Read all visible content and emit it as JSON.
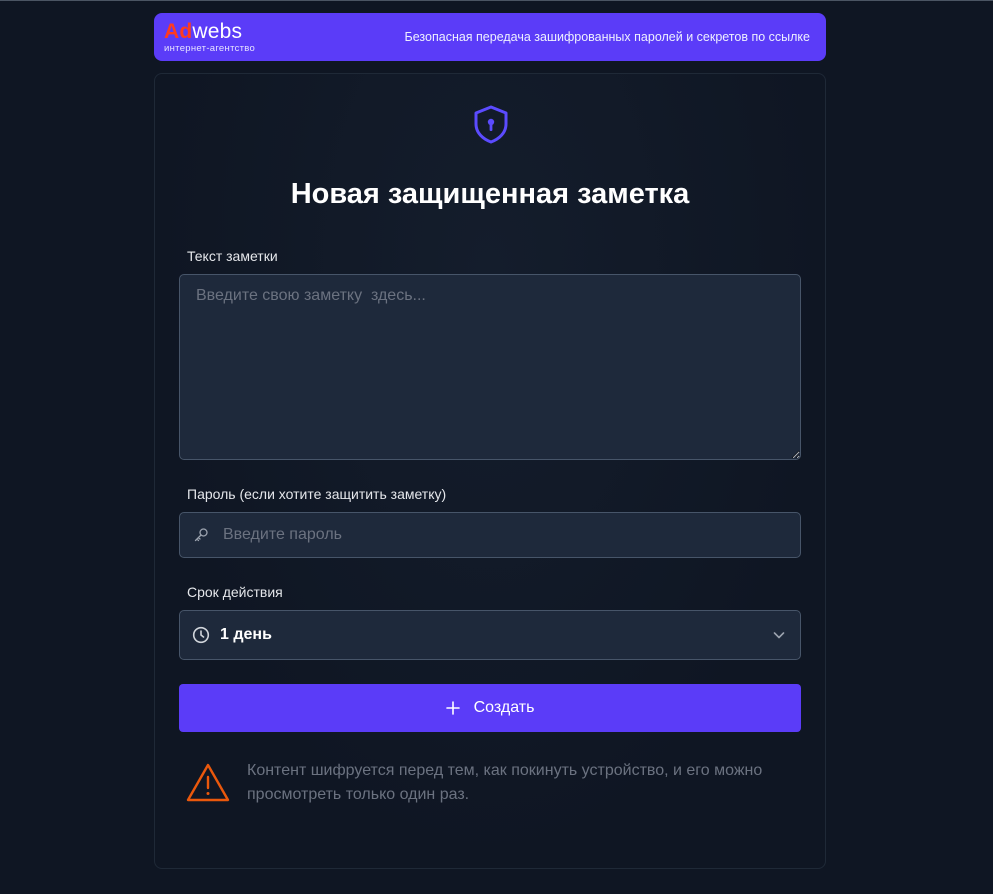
{
  "header": {
    "logo_ad": "Ad",
    "logo_webs": "webs",
    "logo_subtitle": "интернет-агентство",
    "tagline": "Безопасная передача зашифрованных паролей и секретов по ссылке"
  },
  "form": {
    "icon": "shield-lock-icon",
    "title": "Новая защищенная заметка",
    "note_label": "Текст заметки",
    "note_placeholder": "Введите свою заметку  здесь...",
    "password_label": "Пароль (если хотите защитить заметку)",
    "password_placeholder": "Введите пароль",
    "password_icon": "key-icon",
    "expiry_label": "Срок действия",
    "expiry_value": "1 день",
    "expiry_icon": "clock-icon",
    "create_label": "Создать",
    "notice": "Контент шифруется перед тем, как покинуть устройство, и его можно просмотреть только один раз.",
    "notice_icon": "warning-icon"
  },
  "colors": {
    "background": "#0f1623",
    "accent": "#5b3cf8",
    "logo_red": "#ff3b1f",
    "warning": "#ea580c",
    "field_bg": "#1e293b",
    "field_border": "#475569",
    "muted_text": "#6b7280"
  }
}
